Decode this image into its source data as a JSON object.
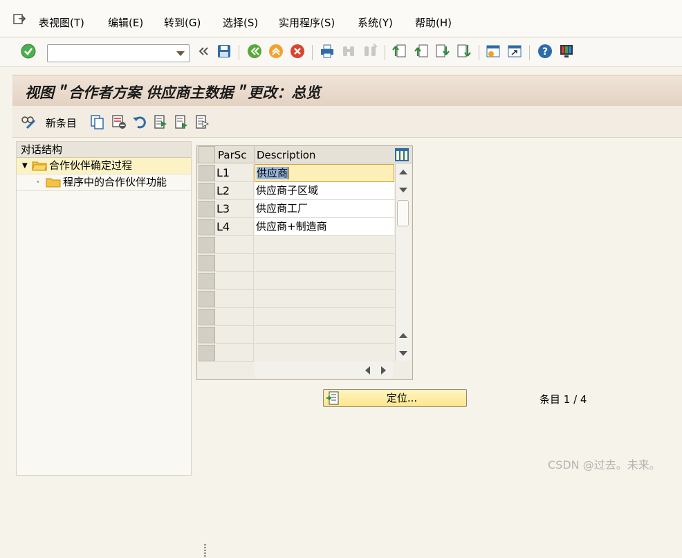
{
  "menu": {
    "items": [
      "表视图(T)",
      "编辑(E)",
      "转到(G)",
      "选择(S)",
      "实用程序(S)",
      "系统(Y)",
      "帮助(H)"
    ]
  },
  "toolbar": {
    "command_field_value": "",
    "icons": [
      "enter-check-icon",
      "back-chevrons-icon",
      "save-icon",
      "back-icon",
      "exit-icon",
      "cancel-icon",
      "print-icon",
      "find-icon",
      "find-next-icon",
      "first-page-icon",
      "prev-page-icon",
      "next-page-icon",
      "last-page-icon",
      "new-session-icon",
      "shortcut-icon",
      "help-icon",
      "customize-layout-icon"
    ]
  },
  "title": "视图＂合作者方案 供应商主数据＂更改：总览",
  "app_toolbar": {
    "new_entries_label": "新条目"
  },
  "dialog_structure": {
    "header": "对话结构",
    "items": [
      {
        "label": "合作伙伴确定过程",
        "selected": true
      },
      {
        "label": "程序中的合作伙伴功能",
        "selected": false
      }
    ]
  },
  "table": {
    "columns": [
      "ParSc",
      "Description"
    ],
    "rows": [
      {
        "code": "L1",
        "desc": "供应商"
      },
      {
        "code": "L2",
        "desc": "供应商子区域"
      },
      {
        "code": "L3",
        "desc": "供应商工厂"
      },
      {
        "code": "L4",
        "desc": "供应商+制造商"
      }
    ],
    "empty_rows": 7
  },
  "locate_button": "定位...",
  "entry_count": "条目 1 / 4",
  "watermark": "CSDN @过去。未来。",
  "colors": {
    "accent_check": "#4caf50",
    "title_bg": "#e8d9c9",
    "selection": "#fcf3c4",
    "locate_button": "#fbe78b"
  }
}
